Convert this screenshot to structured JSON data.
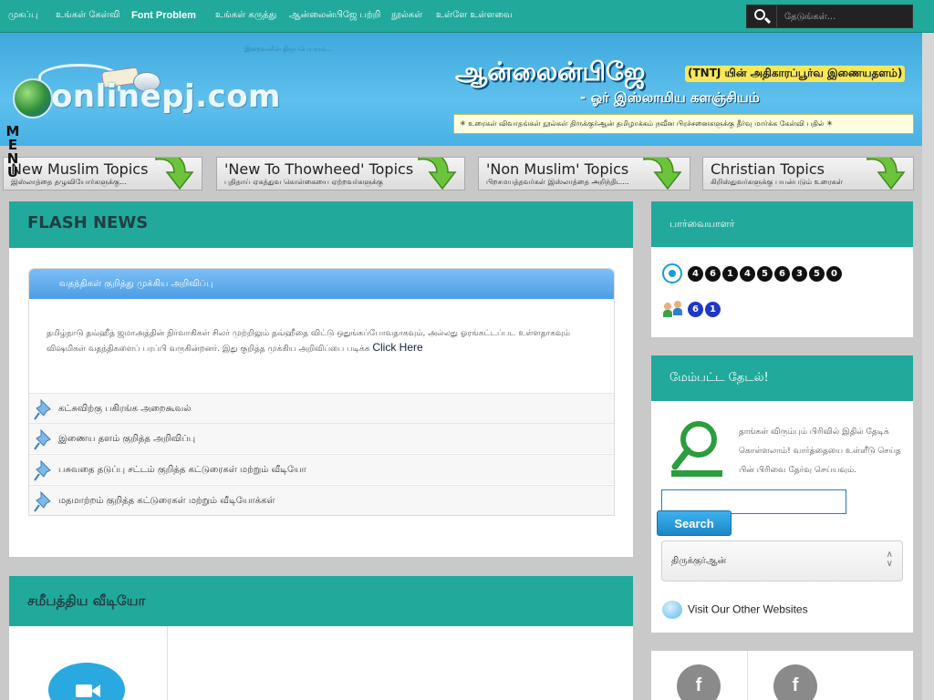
{
  "topnav": {
    "items": [
      {
        "label": "முகப்பு",
        "bold": false
      },
      {
        "label": "உங்கள் கேள்வி",
        "bold": false
      },
      {
        "label": "Font Problem",
        "bold": true
      },
      {
        "label": "உங்கள் கருத்து",
        "bold": false
      },
      {
        "label": "ஆன்லைன்பிஜே பற்றி",
        "bold": false
      },
      {
        "label": "நூல்கள்",
        "bold": false
      },
      {
        "label": "உள்ளே உள்ளவை",
        "bold": false
      }
    ],
    "search_placeholder": "தேடுங்கள்...",
    "search_icon": "search-icon"
  },
  "header": {
    "small_tagline": "இறைவனின் திருப்பெயரால்...",
    "logo_text": "onlinepj.com",
    "title": "ஆன்லைன்பிஜே",
    "title_badge": "(TNTJ யின் அதிகாரப்பூர்வ இணையதளம்)",
    "subtitle": "- ஓர் இஸ்லாமிய களஞ்சியம்",
    "categories": "✳ உரைகள் விவாதங்கள் நூல்கள் திருக்குர்ஆன் தமிழாக்கம் நவீன பிரச்சனைகளுக்கு தீர்வு மார்க்க கேள்வி பதில் ✳"
  },
  "menu_label": "MENU",
  "topics": [
    {
      "title": "New Muslim Topics",
      "subtitle": "இஸ்லாத்தை தழுவியோர்களுக்கு..."
    },
    {
      "title": "'New To Thowheed' Topics",
      "subtitle": "புதிதாய் ஏகத்துவ கொள்கையை ஏற்றவர்களுக்கு"
    },
    {
      "title": "'Non Muslim' Topics",
      "subtitle": "பிறசமயத்தவர்கள் இஸ்லாத்தை அறிந்திட..."
    },
    {
      "title": "Christian Topics",
      "subtitle": "கிறிஸ்துவர்களுக்கு பயன்படும் உரைகள்"
    }
  ],
  "flash_news": {
    "heading": "FLASH NEWS",
    "box_title": "வதந்திகள் குறித்து முக்கிய அறிவிப்பு",
    "body_text": "தமிழ்நாடு தவ்ஹீத் ஜமாஅத்தின் நிர்வாகிகள் சிலர் முற்றிலும் தவ்ஹீதை விட்டு ஒதுங்கப்போவதாகவும், அல்லது ஓரங்கட்டப்பட உள்ளதாகவும் விஷமிகள் வதந்திகளைப் பரப்பி வருகின்றனர். இது குறித்த முக்கிய அறிவிப்பை படிக்க",
    "link": "Click Here",
    "items": [
      "கட்சுவிற்கு பகிரங்க அறைகூவல்",
      "இணைய தளம் குறித்த அறிவிப்பு",
      "பசுவதை தடுப்பு சட்டம் குறித்த கட்டுரைகள் மற்றும் வீடியோ",
      "மதமாற்றம் குறித்த கட்டுரைகள் மற்றும் வீடியோக்கள்"
    ]
  },
  "recent_videos": {
    "heading": "சமீபத்திய வீடியோ",
    "icon": "video-camera-icon"
  },
  "visitors": {
    "heading": "பார்வையாளர்",
    "total_digits": [
      "4",
      "6",
      "1",
      "4",
      "5",
      "6",
      "3",
      "5",
      "0"
    ],
    "online_digits": [
      "6",
      "1"
    ]
  },
  "advanced_search": {
    "heading": "மேம்பட்ட தேடல்!",
    "description": "தாங்கள் விரும்பும் பிரிவில் இதில் தேடிக் கொள்ளலாம்! வார்த்தையை உள்ளீடு செய்த பின் பிரிவை தேர்வு செய்யவும்.",
    "input_value": "",
    "button_label": "Search",
    "select_value": "திருக்குர்ஆன்",
    "other_sites": "Visit Our Other Websites"
  },
  "social": {
    "icons": [
      "facebook-icon",
      "facebook-icon"
    ],
    "glyph": "f"
  },
  "colors": {
    "teal": "#21a99b",
    "header_blue": "#4fb6e8",
    "search_blue": "#1b87c7"
  }
}
